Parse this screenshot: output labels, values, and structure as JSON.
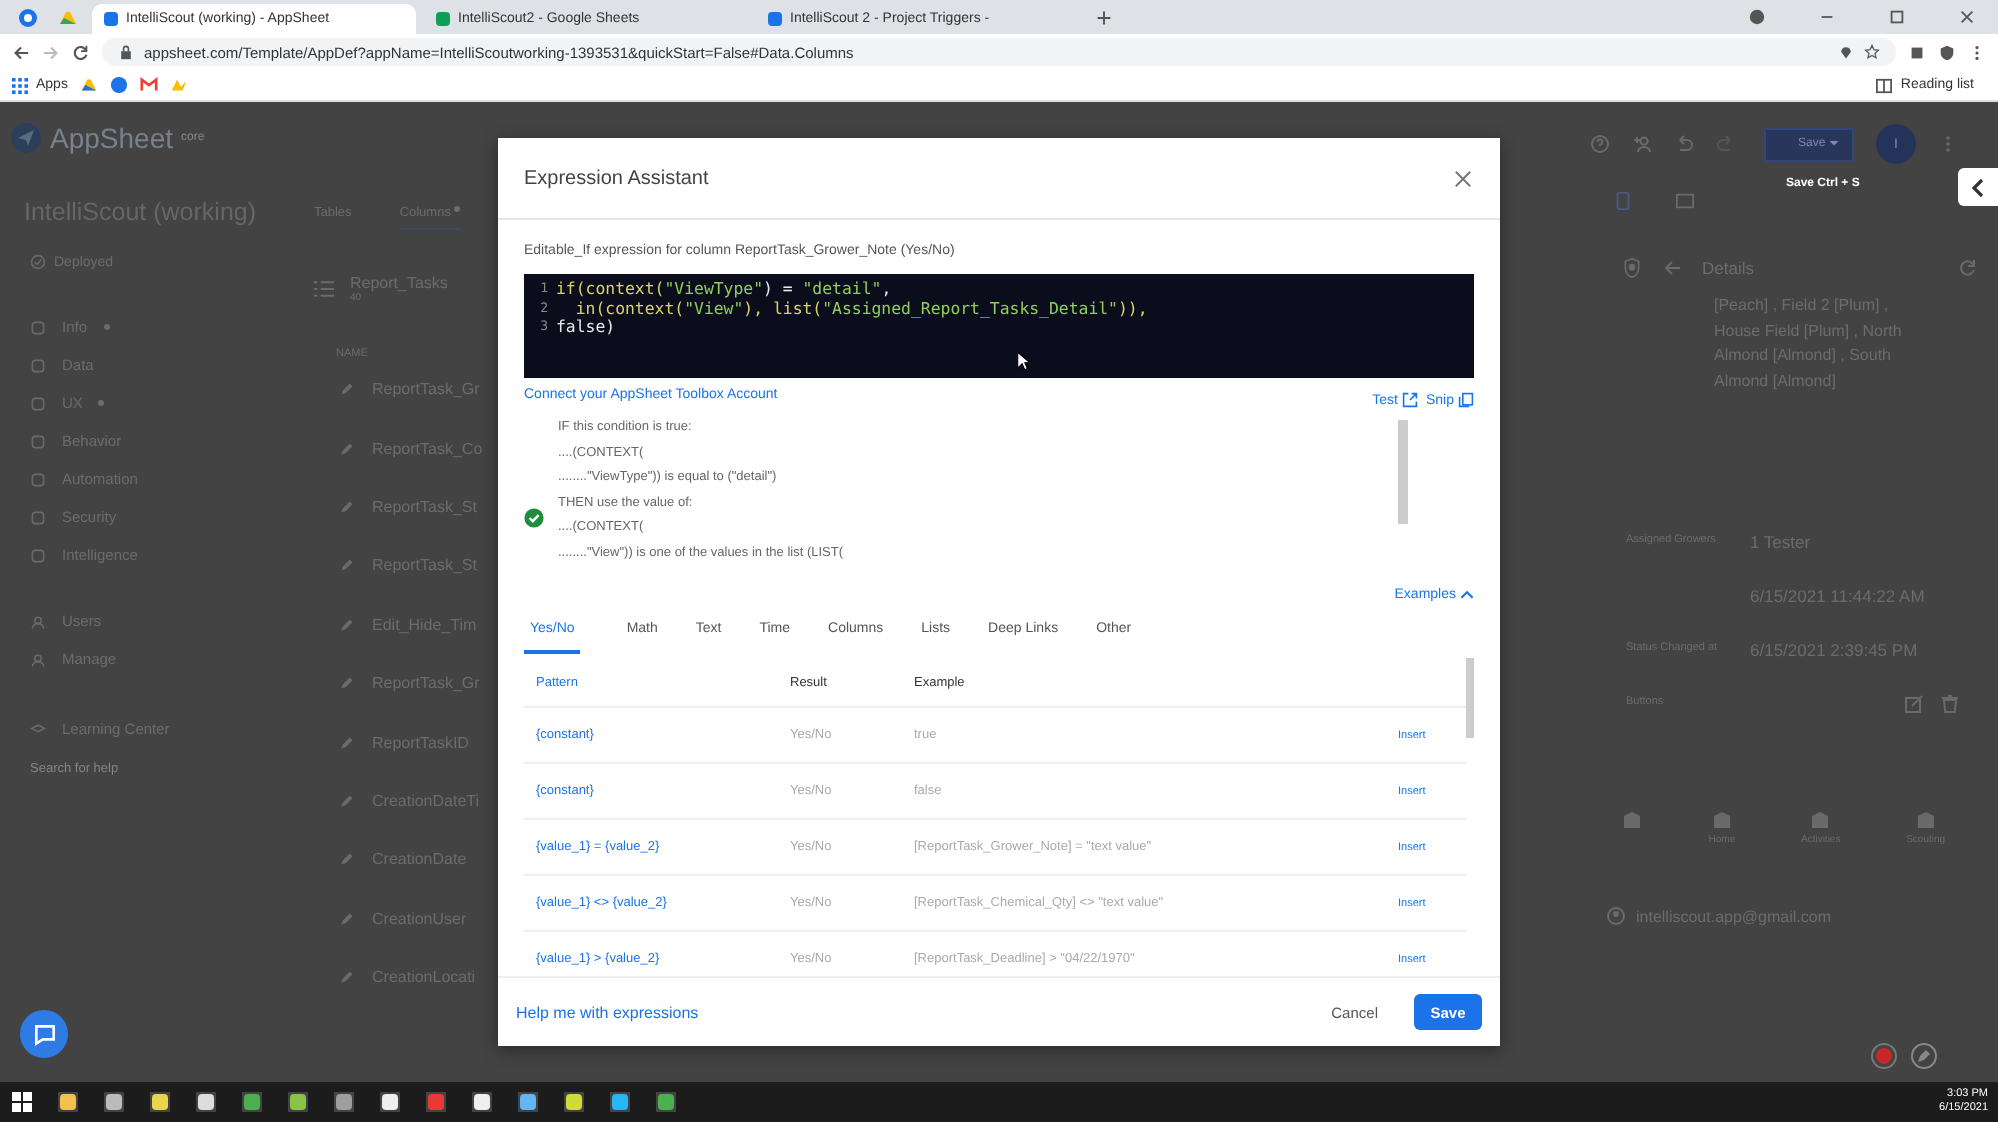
{
  "browser": {
    "tabs": [
      {
        "title": "IntelliScout (working) - AppSheet",
        "selected": true
      },
      {
        "title": "IntelliScout2 - Google Sheets",
        "selected": false
      },
      {
        "title": "IntelliScout 2 - Project Triggers -",
        "selected": false
      }
    ],
    "address": "appsheet.com/Template/AppDef?appName=IntelliScoutworking-1393531&quickStart=False#Data.Columns",
    "bookmarks": [
      {
        "label": "Apps"
      }
    ],
    "reading_list": "Reading list"
  },
  "app": {
    "logo": "AppSheet",
    "edition": "core",
    "app_name": "IntelliScout (working)",
    "status": "Deployed",
    "nav": [
      {
        "label": "Info",
        "modified": true
      },
      {
        "label": "Data",
        "modified": false
      },
      {
        "label": "UX",
        "modified": true
      },
      {
        "label": "Behavior",
        "modified": false
      },
      {
        "label": "Automation",
        "modified": false
      },
      {
        "label": "Security",
        "modified": false
      },
      {
        "label": "Intelligence",
        "modified": false
      }
    ],
    "nav_admin": [
      {
        "label": "Users"
      },
      {
        "label": "Manage"
      }
    ],
    "learning": "Learning Center",
    "search_placeholder": "Search for help"
  },
  "editor": {
    "tabs": [
      {
        "label": "Tables",
        "selected": false,
        "modified": false
      },
      {
        "label": "Columns",
        "selected": true,
        "modified": true
      }
    ],
    "table_name": "Report_Tasks",
    "table_meta": "40",
    "column_header": "NAME",
    "columns": [
      "ReportTask_Gr",
      "ReportTask_Co",
      "ReportTask_St",
      "ReportTask_St",
      "Edit_Hide_Tim",
      "ReportTask_Gr",
      "ReportTaskID",
      "CreationDateTi",
      "CreationDate",
      "CreationUser",
      "CreationLocati"
    ]
  },
  "preview": {
    "save": "Save",
    "tooltip": "Save Ctrl + S",
    "avatar": "I",
    "view_title": "Details",
    "detail_text": "[Peach] , Field 2 [Plum] , House Field [Plum] , North Almond [Almond] , South Almond [Almond]",
    "fields": [
      {
        "kind": "text",
        "label": "Assigned Growers",
        "value": "1 Tester"
      },
      {
        "kind": "text",
        "value": "6/15/2021 11:44:22 AM"
      },
      {
        "kind": "text",
        "label": "Status Changed at",
        "value": "6/15/2021 2:39:45 PM"
      },
      {
        "kind": "actions",
        "label": "Buttons"
      }
    ],
    "nav": [
      {
        "kind": "icon"
      },
      {
        "kind": "labelled",
        "label": "Home"
      },
      {
        "kind": "labelled",
        "label": "Activities"
      },
      {
        "kind": "labelled",
        "label": "Scouting"
      }
    ],
    "account": "intelliscout.app@gmail.com"
  },
  "dialog": {
    "title": "Expression Assistant",
    "description": "Editable_If expression for column ReportTask_Grower_Note (Yes/No)",
    "code": [
      {
        "num": "1",
        "tokens": [
          {
            "text": "if(context(",
            "kind": "fn"
          },
          {
            "text": "\"ViewType\"",
            "kind": "str"
          },
          {
            "text": ") = ",
            "kind": "op"
          },
          {
            "text": "\"detail\"",
            "kind": "str"
          },
          {
            "text": ",",
            "kind": "op"
          }
        ]
      },
      {
        "num": "2",
        "tokens": [
          {
            "text": "  in(context(",
            "kind": "fn"
          },
          {
            "text": "\"View\"",
            "kind": "str"
          },
          {
            "text": "), list(",
            "kind": "fn"
          },
          {
            "text": "\"Assigned_Report_Tasks_Detail\"",
            "kind": "str"
          },
          {
            "text": ")),",
            "kind": "fn"
          }
        ]
      },
      {
        "num": "3",
        "tokens": [
          {
            "text": "false)",
            "kind": "op"
          }
        ]
      }
    ],
    "connect_link": "Connect your AppSheet Toolbox Account",
    "test": "Test",
    "snip": "Snip",
    "valid": true,
    "explanation": [
      "IF this condition is true:",
      "....(CONTEXT(",
      "........\"ViewType\")) is equal to (\"detail\")",
      "THEN use the value of:",
      "....(CONTEXT(",
      "........\"View\")) is one of the values in the list (LIST("
    ],
    "examples": {
      "label": "Examples",
      "expanded": true
    },
    "tabs": [
      {
        "label": "Yes/No",
        "selected": true
      },
      {
        "label": "Math",
        "selected": false
      },
      {
        "label": "Text",
        "selected": false
      },
      {
        "label": "Time",
        "selected": false
      },
      {
        "label": "Columns",
        "selected": false
      },
      {
        "label": "Lists",
        "selected": false
      },
      {
        "label": "Deep Links",
        "selected": false
      },
      {
        "label": "Other",
        "selected": false
      }
    ],
    "table": {
      "columns": [
        "Pattern",
        "Result",
        "Example"
      ],
      "rows": [
        {
          "pattern": "{constant}",
          "result": "Yes/No",
          "example": "true",
          "action": "Insert"
        },
        {
          "pattern": "{constant}",
          "result": "Yes/No",
          "example": "false",
          "action": "Insert"
        },
        {
          "pattern": "{value_1} = {value_2}",
          "result": "Yes/No",
          "example": "[ReportTask_Grower_Note] = \"text value\"",
          "action": "Insert"
        },
        {
          "pattern": "{value_1} <> {value_2}",
          "result": "Yes/No",
          "example": "[ReportTask_Chemical_Qty] <> \"text value\"",
          "action": "Insert"
        },
        {
          "pattern": "{value_1} > {value_2}",
          "result": "Yes/No",
          "example": "[ReportTask_Deadline] > \"04/22/1970\"",
          "action": "Insert"
        }
      ]
    },
    "help": "Help me with expressions",
    "cancel": "Cancel",
    "save": "Save"
  },
  "taskbar": {
    "time": "3:03 PM",
    "date": "6/15/2021"
  }
}
